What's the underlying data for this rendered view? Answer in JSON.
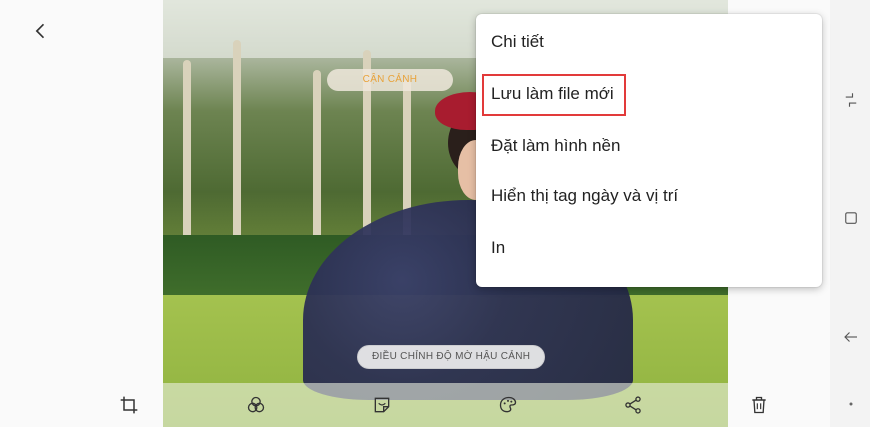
{
  "photo": {
    "top_tag": "CẬN CẢNH",
    "bottom_tag": "ĐIỀU CHỈNH ĐỘ MỜ HẬU CẢNH"
  },
  "menu": {
    "items": [
      {
        "label": "Chi tiết",
        "highlighted": false
      },
      {
        "label": "Lưu làm file mới",
        "highlighted": true
      },
      {
        "label": "Đặt làm hình nền",
        "highlighted": false
      },
      {
        "label": "Hiển thị tag ngày và vị trí",
        "highlighted": false
      },
      {
        "label": "In",
        "highlighted": false
      }
    ]
  },
  "toolbar": {
    "icons": [
      "crop-icon",
      "filter-icon",
      "sticker-icon",
      "paint-icon",
      "share-icon",
      "trash-icon"
    ]
  },
  "navbar": {
    "icons": [
      "recent-apps-icon",
      "home-square-icon",
      "back-arrow-icon",
      "dot-icon"
    ]
  },
  "colors": {
    "highlight_border": "#e23a3a",
    "tag_accent": "#e8a23a"
  }
}
